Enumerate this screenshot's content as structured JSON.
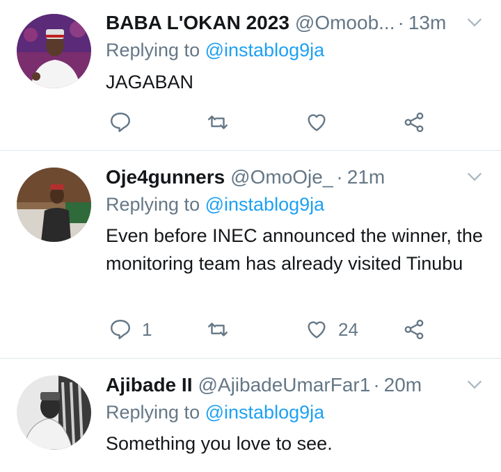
{
  "tweets": [
    {
      "display_name": "BABA L'OKAN 2023",
      "handle": "@Omoob...",
      "time": "13m",
      "replying_prefix": "Replying to",
      "replying_to": "@instablog9ja",
      "text": "JAGABAN",
      "reply_count": "",
      "like_count": ""
    },
    {
      "display_name": "Oje4gunners",
      "handle": "@OmoOje_",
      "time": "21m",
      "replying_prefix": "Replying to",
      "replying_to": "@instablog9ja",
      "text": "Even before INEC announced the winner, the monitoring team has already visited Tinubu",
      "reply_count": "1",
      "like_count": "24"
    },
    {
      "display_name": "Ajibade II",
      "handle": "@AjibadeUmarFar1",
      "time": "20m",
      "replying_prefix": "Replying to",
      "replying_to": "@instablog9ja",
      "text": "Something you love to see.",
      "reply_count": "",
      "like_count": ""
    }
  ],
  "colors": {
    "link": "#1da1f2",
    "secondary_text": "#657786",
    "divider": "#e1e8ed"
  },
  "icons": [
    "reply-icon",
    "retweet-icon",
    "like-icon",
    "share-icon",
    "chevron-down-icon"
  ]
}
